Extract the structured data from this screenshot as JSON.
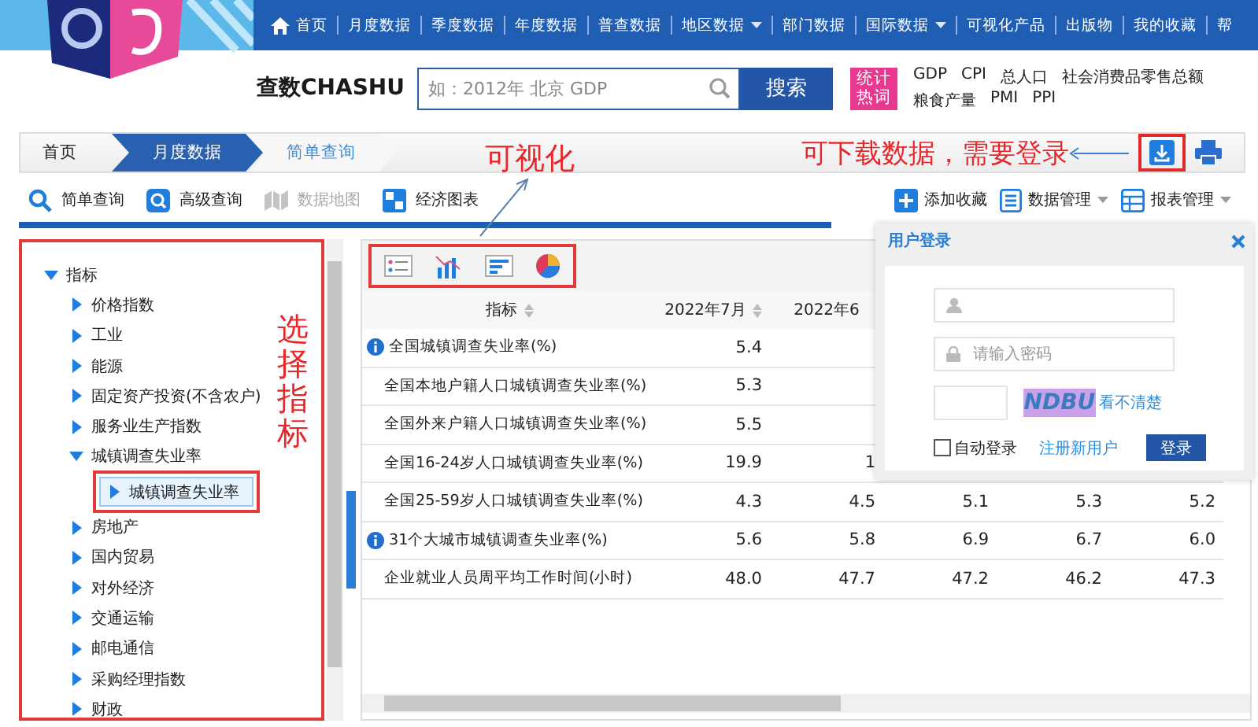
{
  "nav": {
    "items": [
      {
        "label": "首页",
        "kind": "home"
      },
      {
        "label": "月度数据",
        "kind": "link"
      },
      {
        "label": "季度数据",
        "kind": "link"
      },
      {
        "label": "年度数据",
        "kind": "link"
      },
      {
        "label": "普查数据",
        "kind": "link"
      },
      {
        "label": "地区数据",
        "kind": "dropdown"
      },
      {
        "label": "部门数据",
        "kind": "link"
      },
      {
        "label": "国际数据",
        "kind": "dropdown"
      },
      {
        "label": "可视化产品",
        "kind": "link"
      },
      {
        "label": "出版物",
        "kind": "link"
      },
      {
        "label": "我的收藏",
        "kind": "link"
      },
      {
        "label": "帮",
        "kind": "link"
      }
    ]
  },
  "brand": {
    "name": "查数CHASHU"
  },
  "search": {
    "placeholder": "如：2012年 北京 GDP",
    "button": "搜索"
  },
  "hot_words": {
    "badge": "统计热词",
    "items": [
      "GDP",
      "CPI",
      "总人口",
      "社会消费品零售总额",
      "粮食产量",
      "PMI",
      "PPI"
    ]
  },
  "breadcrumb": [
    {
      "label": "首页",
      "kind": "home"
    },
    {
      "label": "月度数据",
      "kind": "section"
    },
    {
      "label": "简单查询",
      "kind": "current"
    }
  ],
  "annotations": {
    "visualize": "可视化",
    "download": "可下载数据，需要登录",
    "choose": "选择指标"
  },
  "toolbar": {
    "left": [
      {
        "label": "简单查询",
        "kind": "search",
        "disabled": false
      },
      {
        "label": "高级查询",
        "kind": "advanced",
        "disabled": false
      },
      {
        "label": "数据地图",
        "kind": "map",
        "disabled": true
      },
      {
        "label": "经济图表",
        "kind": "chart",
        "disabled": false
      }
    ],
    "right": [
      {
        "label": "添加收藏",
        "kind": "add",
        "dropdown": false
      },
      {
        "label": "数据管理",
        "kind": "data",
        "dropdown": true
      },
      {
        "label": "报表管理",
        "kind": "report",
        "dropdown": true
      }
    ]
  },
  "tree": [
    {
      "label": "指标",
      "expanded": true,
      "selected": false,
      "children": [
        {
          "label": "价格指数",
          "expanded": false,
          "selected": false
        },
        {
          "label": "工业",
          "expanded": false,
          "selected": false
        },
        {
          "label": "能源",
          "expanded": false,
          "selected": false
        },
        {
          "label": "固定资产投资(不含农户)",
          "expanded": false,
          "selected": false
        },
        {
          "label": "服务业生产指数",
          "expanded": false,
          "selected": false
        },
        {
          "label": "城镇调查失业率",
          "expanded": true,
          "selected": false,
          "children": [
            {
              "label": "城镇调查失业率",
              "expanded": false,
              "selected": true
            }
          ]
        },
        {
          "label": "房地产",
          "expanded": false,
          "selected": false
        },
        {
          "label": "国内贸易",
          "expanded": false,
          "selected": false
        },
        {
          "label": "对外经济",
          "expanded": false,
          "selected": false
        },
        {
          "label": "交通运输",
          "expanded": false,
          "selected": false
        },
        {
          "label": "邮电通信",
          "expanded": false,
          "selected": false
        },
        {
          "label": "采购经理指数",
          "expanded": false,
          "selected": false
        },
        {
          "label": "财政",
          "expanded": false,
          "selected": false
        }
      ]
    }
  ],
  "table": {
    "columns": [
      {
        "label": "指标",
        "sortable": true
      },
      {
        "label": "2022年7月",
        "sortable": true
      },
      {
        "label": "2022年6",
        "sortable": false
      }
    ],
    "rows": [
      {
        "info": true,
        "cells": [
          "全国城镇调查失业率(%)",
          "5.4"
        ]
      },
      {
        "info": false,
        "cells": [
          "全国本地户籍人口城镇调查失业率(%)",
          "5.3"
        ]
      },
      {
        "info": false,
        "cells": [
          "全国外来户籍人口城镇调查失业率(%)",
          "5.5"
        ]
      },
      {
        "info": false,
        "cells": [
          "全国16-24岁人口城镇调查失业率(%)",
          "19.9",
          "1"
        ]
      },
      {
        "info": false,
        "cells": [
          "全国25-59岁人口城镇调查失业率(%)",
          "4.3",
          "4.5",
          "5.1",
          "5.3",
          "5.2"
        ]
      },
      {
        "info": true,
        "cells": [
          "31个大城市城镇调查失业率(%)",
          "5.6",
          "5.8",
          "6.9",
          "6.7",
          "6.0"
        ]
      },
      {
        "info": false,
        "cells": [
          "企业就业人员周平均工作时间(小时)",
          "48.0",
          "47.7",
          "47.2",
          "46.2",
          "47.3"
        ]
      }
    ]
  },
  "login": {
    "title": "用户登录",
    "password_placeholder": "请输入密码",
    "captcha": "NDBU",
    "refresh_link": "看不清楚",
    "remember": {
      "label": "自动登录",
      "checked": false
    },
    "register_link": "注册新用户",
    "button": "登录"
  }
}
